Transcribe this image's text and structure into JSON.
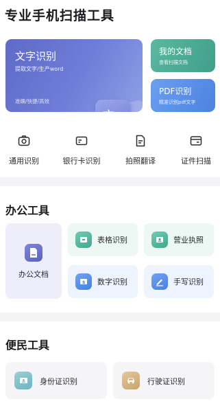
{
  "header": {
    "title": "专业手机扫描工具"
  },
  "hero": {
    "main": {
      "title": "文字识别",
      "subtitle": "提取文字/生产word",
      "features": "准确/快捷/高效"
    },
    "docs": {
      "title": "我的文档",
      "subtitle": "查看扫描文档"
    },
    "pdf": {
      "title": "PDF识别",
      "subtitle": "精准识别pdf文字"
    }
  },
  "quick_actions": [
    {
      "label": "通用识别",
      "icon": "camera-icon"
    },
    {
      "label": "银行卡识别",
      "icon": "bank-card-icon"
    },
    {
      "label": "拍照翻译",
      "icon": "document-icon"
    },
    {
      "label": "证件扫描",
      "icon": "id-card-icon"
    }
  ],
  "office": {
    "title": "办公工具",
    "big": {
      "label": "办公文档",
      "icon": "office-doc-icon"
    },
    "tiles": [
      {
        "label": "表格识别",
        "icon": "table-icon"
      },
      {
        "label": "营业执照",
        "icon": "license-icon"
      },
      {
        "label": "数字识别",
        "icon": "number-icon"
      },
      {
        "label": "手写识别",
        "icon": "pen-icon"
      }
    ]
  },
  "convenience": {
    "title": "便民工具",
    "items": [
      {
        "label": "身份证识别",
        "icon": "id-card-icon"
      },
      {
        "label": "行驶证识别",
        "icon": "car-icon"
      }
    ]
  }
}
